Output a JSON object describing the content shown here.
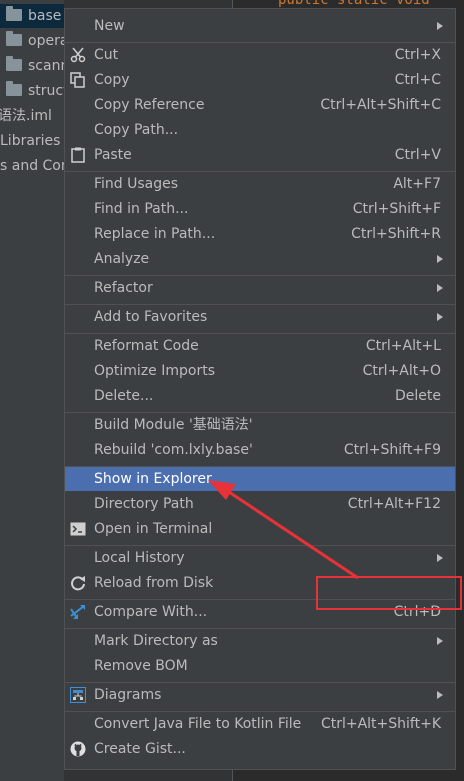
{
  "tree": {
    "items": [
      {
        "label": "base",
        "folder": true
      },
      {
        "label": "opera",
        "folder": true
      },
      {
        "label": "scann",
        "folder": true
      },
      {
        "label": "struct",
        "folder": true
      },
      {
        "label": "语法.iml",
        "folder": false
      },
      {
        "label": "Libraries",
        "folder": false
      },
      {
        "label": "s and Con",
        "folder": false
      }
    ]
  },
  "editor": {
    "code_line": "public static void"
  },
  "menu": {
    "items": [
      {
        "label": "New",
        "shortcut": "",
        "submenu": true,
        "icon": ""
      },
      {
        "label": "Cut",
        "shortcut": "Ctrl+X",
        "submenu": false,
        "icon": "scissors-icon"
      },
      {
        "label": "Copy",
        "shortcut": "Ctrl+C",
        "submenu": false,
        "icon": "copy-icon"
      },
      {
        "label": "Copy Reference",
        "shortcut": "Ctrl+Alt+Shift+C",
        "submenu": false,
        "icon": ""
      },
      {
        "label": "Copy Path...",
        "shortcut": "",
        "submenu": false,
        "icon": ""
      },
      {
        "label": "Paste",
        "shortcut": "Ctrl+V",
        "submenu": false,
        "icon": "paste-icon"
      },
      {
        "label": "Find Usages",
        "shortcut": "Alt+F7",
        "submenu": false,
        "icon": ""
      },
      {
        "label": "Find in Path...",
        "shortcut": "Ctrl+Shift+F",
        "submenu": false,
        "icon": ""
      },
      {
        "label": "Replace in Path...",
        "shortcut": "Ctrl+Shift+R",
        "submenu": false,
        "icon": ""
      },
      {
        "label": "Analyze",
        "shortcut": "",
        "submenu": true,
        "icon": ""
      },
      {
        "label": "Refactor",
        "shortcut": "",
        "submenu": true,
        "icon": ""
      },
      {
        "label": "Add to Favorites",
        "shortcut": "",
        "submenu": true,
        "icon": ""
      },
      {
        "label": "Reformat Code",
        "shortcut": "Ctrl+Alt+L",
        "submenu": false,
        "icon": ""
      },
      {
        "label": "Optimize Imports",
        "shortcut": "Ctrl+Alt+O",
        "submenu": false,
        "icon": ""
      },
      {
        "label": "Delete...",
        "shortcut": "Delete",
        "submenu": false,
        "icon": ""
      },
      {
        "label": "Build Module '基础语法'",
        "shortcut": "",
        "submenu": false,
        "icon": ""
      },
      {
        "label": "Rebuild 'com.lxly.base'",
        "shortcut": "Ctrl+Shift+F9",
        "submenu": false,
        "icon": ""
      },
      {
        "label": "Show in Explorer",
        "shortcut": "",
        "submenu": false,
        "icon": "",
        "highlighted": true
      },
      {
        "label": "Directory Path",
        "shortcut": "Ctrl+Alt+F12",
        "submenu": false,
        "icon": ""
      },
      {
        "label": "Open in Terminal",
        "shortcut": "",
        "submenu": false,
        "icon": "terminal-icon"
      },
      {
        "label": "Local History",
        "shortcut": "",
        "submenu": true,
        "icon": ""
      },
      {
        "label": "Reload from Disk",
        "shortcut": "",
        "submenu": false,
        "icon": "reload-icon"
      },
      {
        "label": "Compare With...",
        "shortcut": "Ctrl+D",
        "submenu": false,
        "icon": "compare-icon"
      },
      {
        "label": "Mark Directory as",
        "shortcut": "",
        "submenu": true,
        "icon": ""
      },
      {
        "label": "Remove BOM",
        "shortcut": "",
        "submenu": false,
        "icon": ""
      },
      {
        "label": "Diagrams",
        "shortcut": "",
        "submenu": true,
        "icon": "diagram-icon"
      },
      {
        "label": "Convert Java File to Kotlin File",
        "shortcut": "Ctrl+Alt+Shift+K",
        "submenu": false,
        "icon": ""
      },
      {
        "label": "Create Gist...",
        "shortcut": "",
        "submenu": false,
        "icon": "github-icon"
      }
    ]
  },
  "colors": {
    "highlight": "#4b6eaf",
    "annotation": "#e8323a"
  }
}
